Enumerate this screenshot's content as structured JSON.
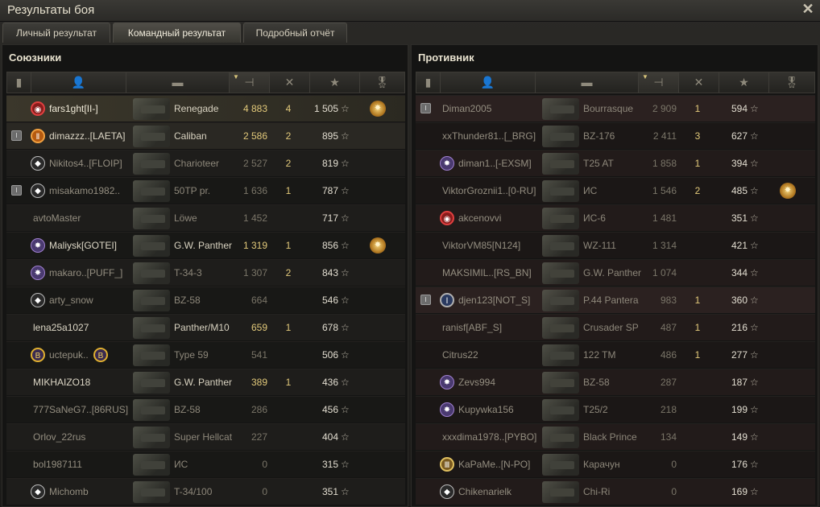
{
  "window": {
    "title": "Результаты боя",
    "close_glyph": "✕"
  },
  "tabs": [
    {
      "label": "Личный результат",
      "active": false
    },
    {
      "label": "Командный результат",
      "active": true
    },
    {
      "label": "Подробный отчёт",
      "active": false
    }
  ],
  "icons": {
    "platoon": "platoon-icon",
    "player": "player-icon",
    "vehicle": "tank-icon",
    "damage": "damage-icon",
    "kills": "kills-icon",
    "xp": "star-icon",
    "medals": "medal-icon"
  },
  "star_glyph": "☆",
  "colors": {
    "highlight_gold": "#e2c97a",
    "dim_text": "#8d877a"
  },
  "allies": {
    "title": "Союзники",
    "rows": [
      {
        "platoon": "",
        "badge": "red",
        "name": "fars1ght[II-]",
        "vehicle": "Renegade",
        "damage": "4 883",
        "kills": "4",
        "xp": "1 505",
        "medal": true,
        "me": true,
        "alive": true
      },
      {
        "platoon": "I",
        "badge": "orange",
        "name": "dimazzz..[LAETA]",
        "vehicle": "Caliban",
        "damage": "2 586",
        "kills": "2",
        "xp": "895",
        "medal": false,
        "alive": true,
        "hl": true
      },
      {
        "platoon": "",
        "badge": "white",
        "name": "Nikitos4..[FLOIP]",
        "vehicle": "Charioteer",
        "damage": "2 527",
        "kills": "2",
        "xp": "819",
        "medal": false,
        "alive": false
      },
      {
        "platoon": "I",
        "badge": "white",
        "name": "misakamo1982..",
        "vehicle": "50TP pr.",
        "damage": "1 636",
        "kills": "1",
        "xp": "787",
        "medal": false,
        "alive": false
      },
      {
        "platoon": "",
        "badge": "",
        "name": "avtoMaster",
        "vehicle": "Löwe",
        "damage": "1 452",
        "kills": "",
        "xp": "717",
        "medal": false,
        "alive": false
      },
      {
        "platoon": "",
        "badge": "star",
        "name": "Maliysk[GOTEI]",
        "vehicle": "G.W. Panther",
        "damage": "1 319",
        "kills": "1",
        "xp": "856",
        "medal": true,
        "alive": true
      },
      {
        "platoon": "",
        "badge": "star",
        "name": "makaro..[PUFF_]",
        "vehicle": "T-34-3",
        "damage": "1 307",
        "kills": "2",
        "xp": "843",
        "medal": false,
        "alive": false
      },
      {
        "platoon": "",
        "badge": "white",
        "name": "arty_snow",
        "vehicle": "BZ-58",
        "damage": "664",
        "kills": "",
        "xp": "546",
        "medal": false,
        "alive": false
      },
      {
        "platoon": "",
        "badge": "",
        "name": "lena25a1027",
        "vehicle": "Panther/M10",
        "damage": "659",
        "kills": "1",
        "xp": "678",
        "medal": false,
        "alive": true
      },
      {
        "platoon": "",
        "badge": "gold",
        "name": "uctepuk..",
        "vehicle": "Type 59",
        "damage": "541",
        "kills": "",
        "xp": "506",
        "medal": false,
        "alive": false,
        "extra": "B"
      },
      {
        "platoon": "",
        "badge": "",
        "name": "MIKHAIZO18",
        "vehicle": "G.W. Panther",
        "damage": "389",
        "kills": "1",
        "xp": "436",
        "medal": false,
        "alive": true
      },
      {
        "platoon": "",
        "badge": "",
        "name": "777SaNeG7..[86RUS]",
        "vehicle": "BZ-58",
        "damage": "286",
        "kills": "",
        "xp": "456",
        "medal": false,
        "alive": false
      },
      {
        "platoon": "",
        "badge": "",
        "name": "Orlov_22rus",
        "vehicle": "Super Hellcat",
        "damage": "227",
        "kills": "",
        "xp": "404",
        "medal": false,
        "alive": false
      },
      {
        "platoon": "",
        "badge": "",
        "name": "bol1987111",
        "vehicle": "ИС",
        "damage": "0",
        "kills": "",
        "xp": "315",
        "medal": false,
        "alive": false
      },
      {
        "platoon": "",
        "badge": "white",
        "name": "Michomb",
        "vehicle": "T-34/100",
        "damage": "0",
        "kills": "",
        "xp": "351",
        "medal": false,
        "alive": false
      }
    ]
  },
  "enemies": {
    "title": "Противник",
    "rows": [
      {
        "platoon": "I",
        "badge": "",
        "name": "Diman2005",
        "vehicle": "Bourrasque",
        "damage": "2 909",
        "kills": "1",
        "xp": "594",
        "medal": false,
        "alive": false,
        "hl": true
      },
      {
        "platoon": "",
        "badge": "",
        "name": "xxThunder81..[_BRG]",
        "vehicle": "BZ-176",
        "damage": "2 411",
        "kills": "3",
        "xp": "627",
        "medal": false,
        "alive": false
      },
      {
        "platoon": "",
        "badge": "star",
        "name": "diman1..[-EXSM]",
        "vehicle": "T25 AT",
        "damage": "1 858",
        "kills": "1",
        "xp": "394",
        "medal": false,
        "alive": false
      },
      {
        "platoon": "",
        "badge": "",
        "name": "ViktorGroznii1..[0-RU]",
        "vehicle": "ИС",
        "damage": "1 546",
        "kills": "2",
        "xp": "485",
        "medal": true,
        "alive": false
      },
      {
        "platoon": "",
        "badge": "red",
        "name": "akcenovvi",
        "vehicle": "ИС-6",
        "damage": "1 481",
        "kills": "",
        "xp": "351",
        "medal": false,
        "alive": false
      },
      {
        "platoon": "",
        "badge": "",
        "name": "ViktorVM85[N124]",
        "vehicle": "WZ-111",
        "damage": "1 314",
        "kills": "",
        "xp": "421",
        "medal": false,
        "alive": false
      },
      {
        "platoon": "",
        "badge": "",
        "name": "MAKSIMIL..[RS_BN]",
        "vehicle": "G.W. Panther",
        "damage": "1 074",
        "kills": "",
        "xp": "344",
        "medal": false,
        "alive": false
      },
      {
        "platoon": "I",
        "badge": "blue",
        "name": "djen123[NOT_S]",
        "vehicle": "P.44 Pantera",
        "damage": "983",
        "kills": "1",
        "xp": "360",
        "medal": false,
        "alive": false,
        "hl": true
      },
      {
        "platoon": "",
        "badge": "",
        "name": "ranisf[ABF_S]",
        "vehicle": "Crusader SP",
        "damage": "487",
        "kills": "1",
        "xp": "216",
        "medal": false,
        "alive": false
      },
      {
        "platoon": "",
        "badge": "",
        "name": "Citrus22",
        "vehicle": "122 TM",
        "damage": "486",
        "kills": "1",
        "xp": "277",
        "medal": false,
        "alive": false
      },
      {
        "platoon": "",
        "badge": "star",
        "name": "Zevs994",
        "vehicle": "BZ-58",
        "damage": "287",
        "kills": "",
        "xp": "187",
        "medal": false,
        "alive": false
      },
      {
        "platoon": "",
        "badge": "star",
        "name": "Kupywka156",
        "vehicle": "T25/2",
        "damage": "218",
        "kills": "",
        "xp": "199",
        "medal": false,
        "alive": false
      },
      {
        "platoon": "",
        "badge": "",
        "name": "xxxdima1978..[PYBO]",
        "vehicle": "Black Prince",
        "damage": "134",
        "kills": "",
        "xp": "149",
        "medal": false,
        "alive": false
      },
      {
        "platoon": "",
        "badge": "shield",
        "name": "KaPaMe..[N-PO]",
        "vehicle": "Карачун",
        "damage": "0",
        "kills": "",
        "xp": "176",
        "medal": false,
        "alive": false
      },
      {
        "platoon": "",
        "badge": "white",
        "name": "Chikenarielk",
        "vehicle": "Chi-Ri",
        "damage": "0",
        "kills": "",
        "xp": "169",
        "medal": false,
        "alive": false
      }
    ]
  }
}
